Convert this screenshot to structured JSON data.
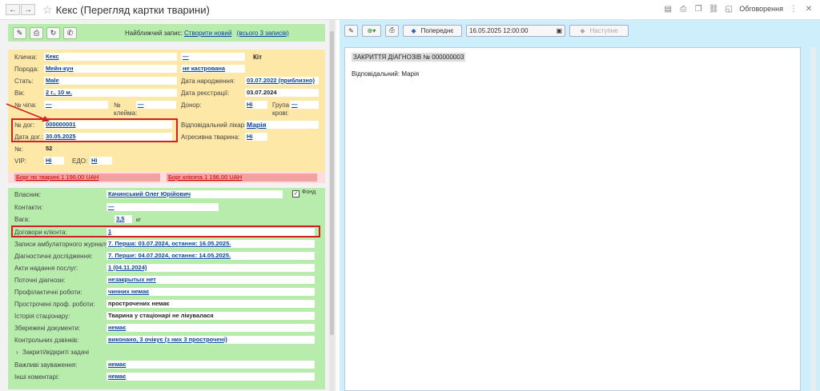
{
  "window": {
    "title": "Кекс (Перегляд картки тварини)",
    "discussions_label": "Обговорення"
  },
  "left_toolbar": {
    "nearest_label": "Найближчий запис:",
    "create_new": "Створити новий",
    "all_records": "(всього 3 записів)"
  },
  "animal": {
    "nickname_label": "Кличка:",
    "nickname": "Кекс",
    "breed_label": "Порода:",
    "breed": "Мейн-кун",
    "sex_label": "Стать:",
    "sex": "Male",
    "age_label": "Вік:",
    "age": "2 г., 10 м.",
    "chip_label": "№ чіпа:",
    "chip": "—",
    "brand_label": "№ клейма:",
    "brand": "—",
    "contract_label": "№ дог:",
    "contract": "000000001",
    "contract_date_label": "Дата дог.:",
    "contract_date": "30.05.2025",
    "num_label": "№:",
    "num": "52",
    "vip_label": "VIP:",
    "vip": "Ні",
    "edo_label": "ЕДО:",
    "edo": "Ні",
    "species": "—",
    "species_value": "Кіт",
    "neutered": "не кастрована",
    "birth_label": "Дата народження:",
    "birth": "03.07.2022 (приблизно)",
    "reg_label": "Дата реєстрації:",
    "reg": "03.07.2024",
    "donor_label": "Донор:",
    "donor": "Ні",
    "blood_label": "Група крові:",
    "blood": "—",
    "doctor_label": "Відповідальний лікар:",
    "doctor": "Марія",
    "aggr_label": "Агресивна тварина:",
    "aggr": "Ні"
  },
  "debts": {
    "animal_debt": "Борг по тварині 1 196,00 UAH",
    "client_debt": "Борг клієнта 1 196,00 UAH"
  },
  "owner": {
    "owner_label": "Власник:",
    "owner": "Качинський Олег Юрійович",
    "fond_label": "Фонд",
    "contacts_label": "Контакти:",
    "contacts": "—",
    "weight_label": "Вага:",
    "weight": "3,5",
    "weight_unit": "кг",
    "contracts_label": "Договори клієнта:",
    "contracts": "1",
    "journal_label": "Записи амбулаторного журналу:",
    "journal": "7. Перша: 03.07.2024, остання: 16.05.2025.",
    "diag_research_label": "Діагностичні дослідження:",
    "diag_research": "7. Перше: 04.07.2024, останнє: 14.05.2025.",
    "acts_label": "Акти надання послуг:",
    "acts": "1 (04.11.2024)",
    "cur_diag_label": "Поточні діагнози:",
    "cur_diag": "незакрытых нет",
    "prophyl_label": "Профілактичні роботи:",
    "prophyl": "чинних немає",
    "overdue_label": "Прострочені проф. роботи:",
    "overdue": "прострочених немає",
    "hosp_label": "Історія стаціонару:",
    "hosp": "Тварина у стаціонарі не лікувалася",
    "docs_label": "Збережені документи:",
    "docs": "немає",
    "calls_label": "Контрольних дзвінків:",
    "calls": "виконано, 3 очікує (з них 3 прострочені)",
    "tasks_label": "Закриті/відкриті задачі",
    "notes_label": "Важливі зауваження:",
    "notes": "немає",
    "comments_label": "Інші коментарі:",
    "comments": "немає"
  },
  "right_toolbar": {
    "prev_label": "Попереднє",
    "datetime": "16.05.2025 12:00:00",
    "next_label": "Наступне"
  },
  "document": {
    "title": "ЗАКРИТТЯ ДІАГНОЗІВ № 000000003",
    "responsible": "Відповідальний: Марія"
  }
}
